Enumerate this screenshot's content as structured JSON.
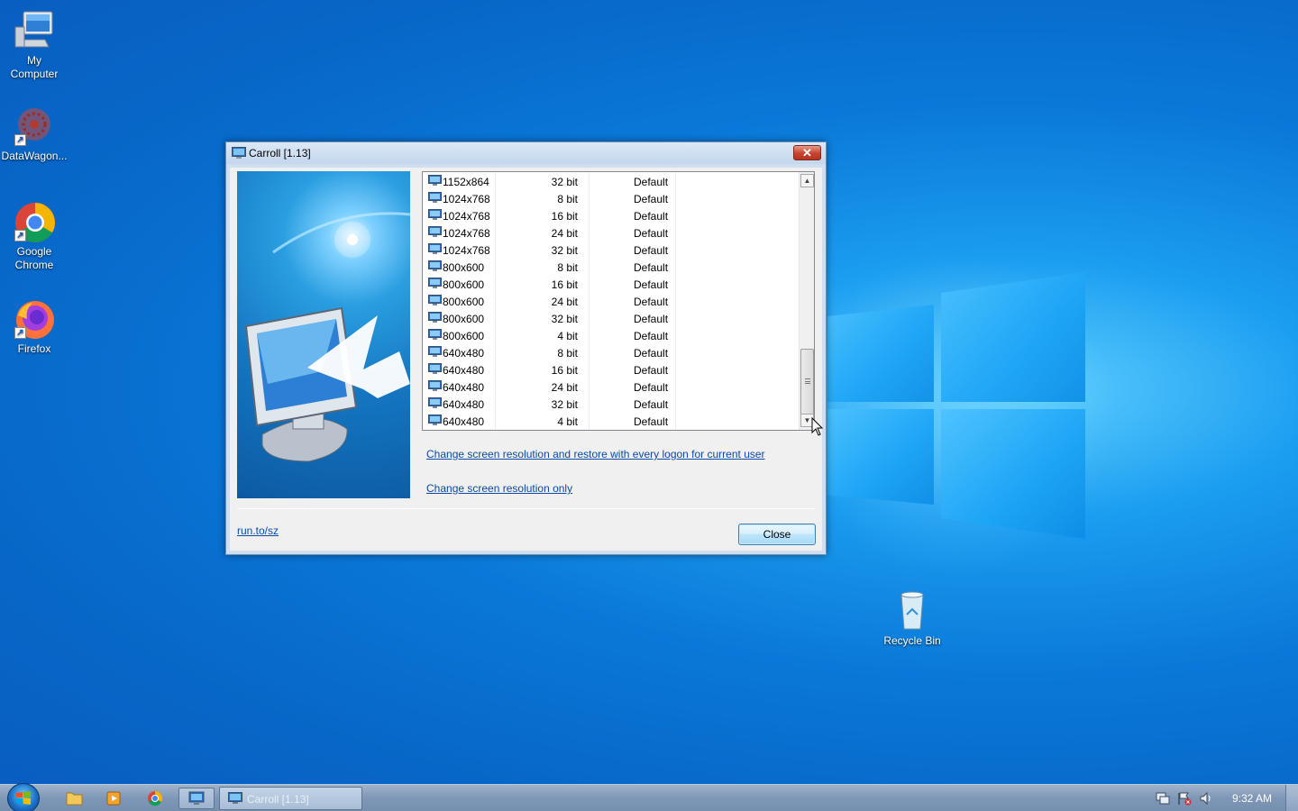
{
  "desktop": {
    "icons": [
      {
        "label": "My\nComputer"
      },
      {
        "label": "DataWagon..."
      },
      {
        "label": "Google\nChrome"
      },
      {
        "label": "Firefox"
      },
      {
        "label": "Recycle Bin"
      }
    ]
  },
  "dialog": {
    "title": "Carroll [1.13]",
    "close_glyph": "✕",
    "modes": [
      {
        "res": "1152x864",
        "bits": "32 bit",
        "freq": "Default"
      },
      {
        "res": "1024x768",
        "bits": "8 bit",
        "freq": "Default"
      },
      {
        "res": "1024x768",
        "bits": "16 bit",
        "freq": "Default"
      },
      {
        "res": "1024x768",
        "bits": "24 bit",
        "freq": "Default"
      },
      {
        "res": "1024x768",
        "bits": "32 bit",
        "freq": "Default"
      },
      {
        "res": "800x600",
        "bits": "8 bit",
        "freq": "Default"
      },
      {
        "res": "800x600",
        "bits": "16 bit",
        "freq": "Default"
      },
      {
        "res": "800x600",
        "bits": "24 bit",
        "freq": "Default"
      },
      {
        "res": "800x600",
        "bits": "32 bit",
        "freq": "Default"
      },
      {
        "res": "800x600",
        "bits": "4 bit",
        "freq": "Default"
      },
      {
        "res": "640x480",
        "bits": "8 bit",
        "freq": "Default"
      },
      {
        "res": "640x480",
        "bits": "16 bit",
        "freq": "Default"
      },
      {
        "res": "640x480",
        "bits": "24 bit",
        "freq": "Default"
      },
      {
        "res": "640x480",
        "bits": "32 bit",
        "freq": "Default"
      },
      {
        "res": "640x480",
        "bits": "4 bit",
        "freq": "Default"
      }
    ],
    "link_restore": "Change screen resolution and restore with every logon for current user",
    "link_only": "Change screen resolution only",
    "site_link": "run.to/sz",
    "close_button": "Close"
  },
  "taskbar": {
    "task_label": "Carroll [1.13]",
    "clock": "9:32 AM"
  }
}
